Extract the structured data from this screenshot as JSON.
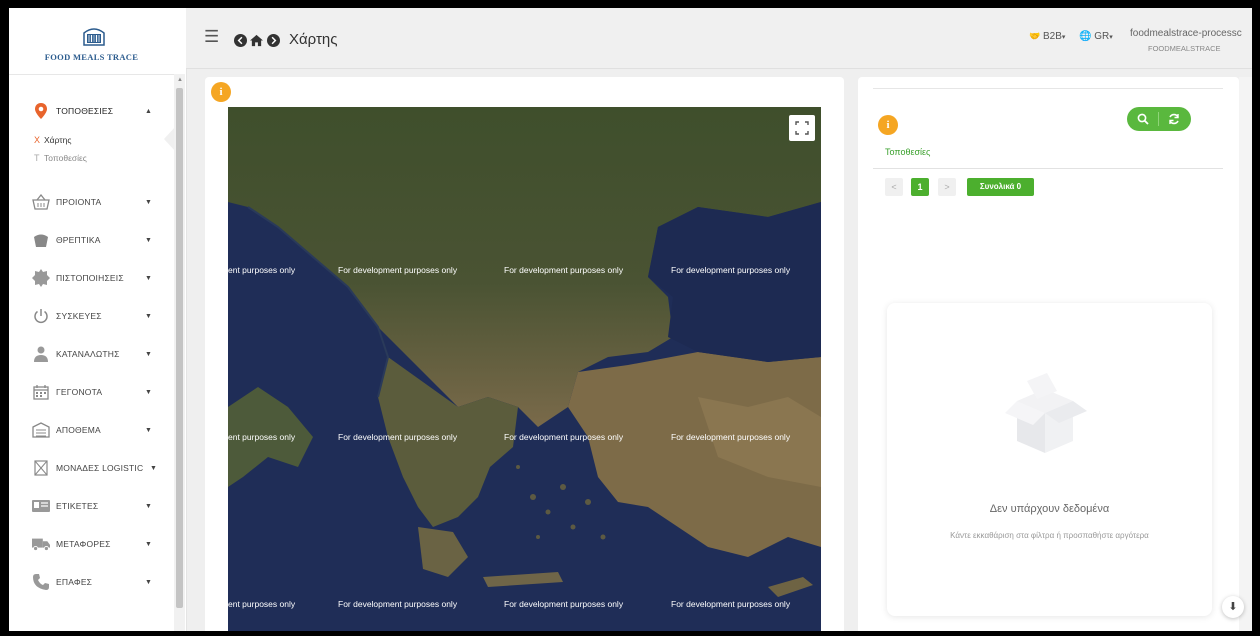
{
  "app": {
    "logo_text": "FOOD MEALS TRACE"
  },
  "header": {
    "menu_icon": "hamburger-icon",
    "nav_icons": [
      "back-icon",
      "home-icon",
      "forward-icon"
    ],
    "page_title": "Χάρτης",
    "mode": "B2B",
    "language": "GR",
    "user_name": "foodmealstrace-processc",
    "user_org": "FOODMEALSTRACE"
  },
  "sidebar": {
    "items": [
      {
        "label": "ΤΟΠΟΘΕΣΙΕΣ",
        "icon": "location-pin-icon",
        "expanded": true
      },
      {
        "label": "ΠΡΟΙΟΝΤΑ",
        "icon": "basket-icon"
      },
      {
        "label": "ΘΡΕΠΤΙΚΑ",
        "icon": "nutrition-icon"
      },
      {
        "label": "ΠΙΣΤΟΠΟΙΗΣΕΙΣ",
        "icon": "certificate-seal-icon"
      },
      {
        "label": "ΣΥΣΚΕΥΕΣ",
        "icon": "power-icon"
      },
      {
        "label": "ΚΑΤΑΝΑΛΩΤΗΣ",
        "icon": "user-icon"
      },
      {
        "label": "ΓΕΓΟΝΟΤΑ",
        "icon": "calendar-icon"
      },
      {
        "label": "ΑΠΟΘΕΜΑ",
        "icon": "warehouse-icon"
      },
      {
        "label": "ΜΟΝΑΔΕΣ LOGISTIC",
        "icon": "logistic-box-icon"
      },
      {
        "label": "ΕΤΙΚΕΤΕΣ",
        "icon": "label-card-icon"
      },
      {
        "label": "ΜΕΤΑΦΟΡΕΣ",
        "icon": "truck-icon"
      },
      {
        "label": "ΕΠΑΦΕΣ",
        "icon": "phone-icon"
      }
    ],
    "subitems": [
      {
        "mark": "X",
        "label": "Χάρτης",
        "active": true
      },
      {
        "mark": "T",
        "label": "Τοποθεσίες",
        "active": false
      }
    ]
  },
  "map": {
    "watermark": "For development purposes only",
    "watermark_clipped": "ent purposes only",
    "fullscreen_icon": "fullscreen-icon"
  },
  "panel": {
    "tab_label": "Τοποθεσίες",
    "search_icon": "search-icon",
    "refresh_icon": "refresh-icon",
    "current_page": "1",
    "prev_label": "<",
    "next_label": ">",
    "total_label": "Συνολικά 0",
    "empty_title": "Δεν υπάρχουν δεδομένα",
    "empty_subtitle": "Κάντε εκκαθάριση στα φίλτρα ή προσπαθήστε αργότερα"
  },
  "colors": {
    "accent_green": "#4caf2e",
    "info_orange": "#f5a623",
    "active_orange": "#e8642c",
    "map_sea": "#1e2c55"
  }
}
